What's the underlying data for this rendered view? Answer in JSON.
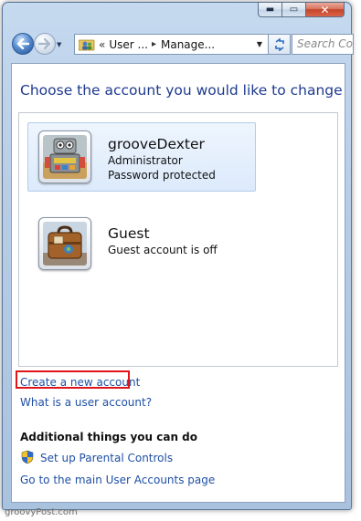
{
  "window": {
    "caption_buttons": {
      "minimize_glyph": "▬",
      "maximize_glyph": "▭",
      "close_glyph": "✕"
    }
  },
  "nav": {
    "address": {
      "chevron": "«",
      "crumbs": [
        "User ...",
        "Manage..."
      ],
      "separator": "▸"
    },
    "search_placeholder": "Search Con"
  },
  "main": {
    "heading": "Choose the account you would like to change",
    "accounts": [
      {
        "name": "grooveDexter",
        "lines": [
          "Administrator",
          "Password protected"
        ],
        "selected": true
      },
      {
        "name": "Guest",
        "lines": [
          "Guest account is off"
        ],
        "selected": false
      }
    ],
    "links": {
      "create": "Create a new account",
      "what_is": "What is a user account?"
    },
    "additional": {
      "title": "Additional things you can do",
      "parental": "Set up Parental Controls",
      "main_page": "Go to the main User Accounts page"
    }
  },
  "watermark": "groovyPost.com",
  "colors": {
    "heading": "#1e3a8e",
    "link": "#1e4fa5",
    "highlight": "#e0141b"
  },
  "icons": [
    "back-arrow-icon",
    "forward-arrow-icon",
    "folder-users-icon",
    "refresh-icon",
    "robot-avatar-icon",
    "suitcase-avatar-icon",
    "uac-shield-icon"
  ]
}
